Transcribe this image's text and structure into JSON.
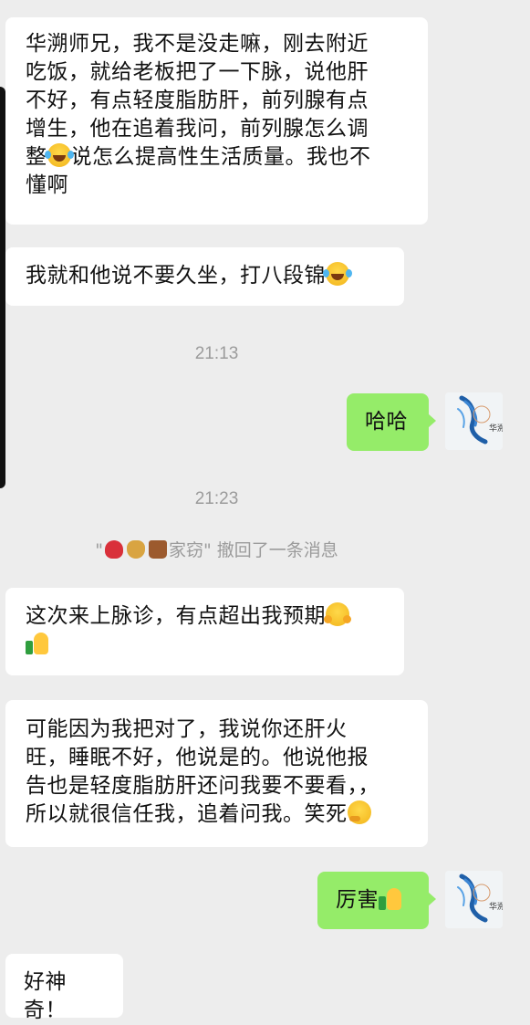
{
  "messages": [
    {
      "id": "m1",
      "direction": "in",
      "lines": [
        "华溯师兄，我不是没走嘛，刚去附近",
        "吃饭，就给老板把了一下脉，说他肝",
        "不好，有点轻度脂肪肝，前列腺有点",
        "增生，他在追着我问，前列腺怎么调",
        "整",
        "说怎么提高性生活质量。我也不",
        "懂啊"
      ],
      "emoji": "laughing-crying-emoji"
    },
    {
      "id": "m2",
      "direction": "in",
      "text": "我就和他说不要久坐，打八段锦",
      "emoji": "laughing-crying-emoji"
    },
    {
      "id": "m3",
      "direction": "out",
      "text": "哈哈"
    },
    {
      "id": "m4",
      "direction": "in",
      "text": "这次来上脉诊，有点超出我预期",
      "emoji": "hugging-emoji",
      "emoji2": "thumbs-up-emoji"
    },
    {
      "id": "m5",
      "direction": "in",
      "lines": [
        "可能因为我把对了，我说你还肝火",
        "旺，睡眠不好，他说是的。他说他报",
        "告也是轻度脂肪肝还问我要不要看，，",
        "所以就很信任我，追着问我。笑死"
      ],
      "emoji": "thinking-emoji"
    },
    {
      "id": "m6",
      "direction": "out",
      "text": "厉害",
      "emoji": "thumbs-up-emoji"
    },
    {
      "id": "m7",
      "direction": "in",
      "text": "好神奇！"
    }
  ],
  "timestamps": [
    "21:13",
    "21:23"
  ],
  "system_notice": {
    "name_prefix": "\"",
    "name_suffix": "家窃\"",
    "action": " 撤回了一条消息",
    "name_icons": [
      "lips-icon",
      "money-bag-icon",
      "handbag-icon"
    ]
  },
  "self_avatar": {
    "caption": "华溯",
    "icon": "self-avatar-icon"
  },
  "colors": {
    "background": "#ededed",
    "incoming_bubble": "#ffffff",
    "outgoing_bubble": "#95ec69",
    "timestamp_text": "#9b9b9b"
  }
}
